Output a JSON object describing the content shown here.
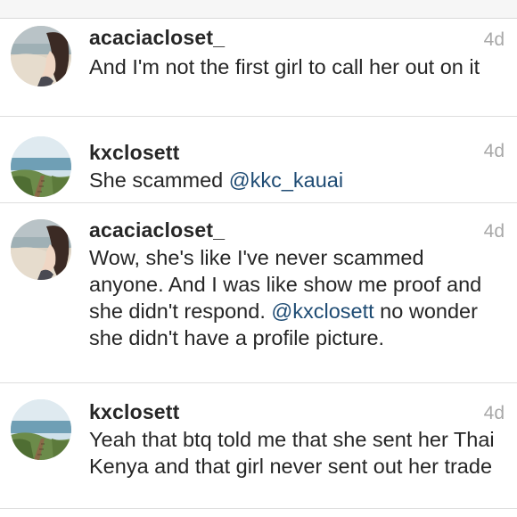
{
  "comments": [
    {
      "username": "acaciacloset_",
      "time": "4d",
      "text_parts": [
        {
          "type": "text",
          "value": "And I'm not the first girl to call her out on it"
        }
      ]
    },
    {
      "username": "kxclosett",
      "time": "4d",
      "text_parts": [
        {
          "type": "text",
          "value": "She scammed "
        },
        {
          "type": "mention",
          "value": "@kkc_kauai"
        }
      ]
    },
    {
      "username": "acaciacloset_",
      "time": "4d",
      "text_parts": [
        {
          "type": "text",
          "value": "Wow, she's like I've never scammed anyone. And I was like show me proof and she didn't respond. "
        },
        {
          "type": "mention",
          "value": "@kxclosett"
        },
        {
          "type": "text",
          "value": " no wonder she didn't have a profile picture."
        }
      ]
    },
    {
      "username": "kxclosett",
      "time": "4d",
      "text_parts": [
        {
          "type": "text",
          "value": "Yeah that btq told me that she sent her Thai Kenya and that girl never sent out her trade"
        }
      ]
    }
  ],
  "colors": {
    "mention": "#1e4b73",
    "username": "#262626",
    "timestamp": "#a8a8a8",
    "divider": "#dedede"
  },
  "icons": {
    "avatar_acaciacloset": "beach-photo-avatar",
    "avatar_kxclosett": "coastal-stairs-photo-avatar"
  }
}
